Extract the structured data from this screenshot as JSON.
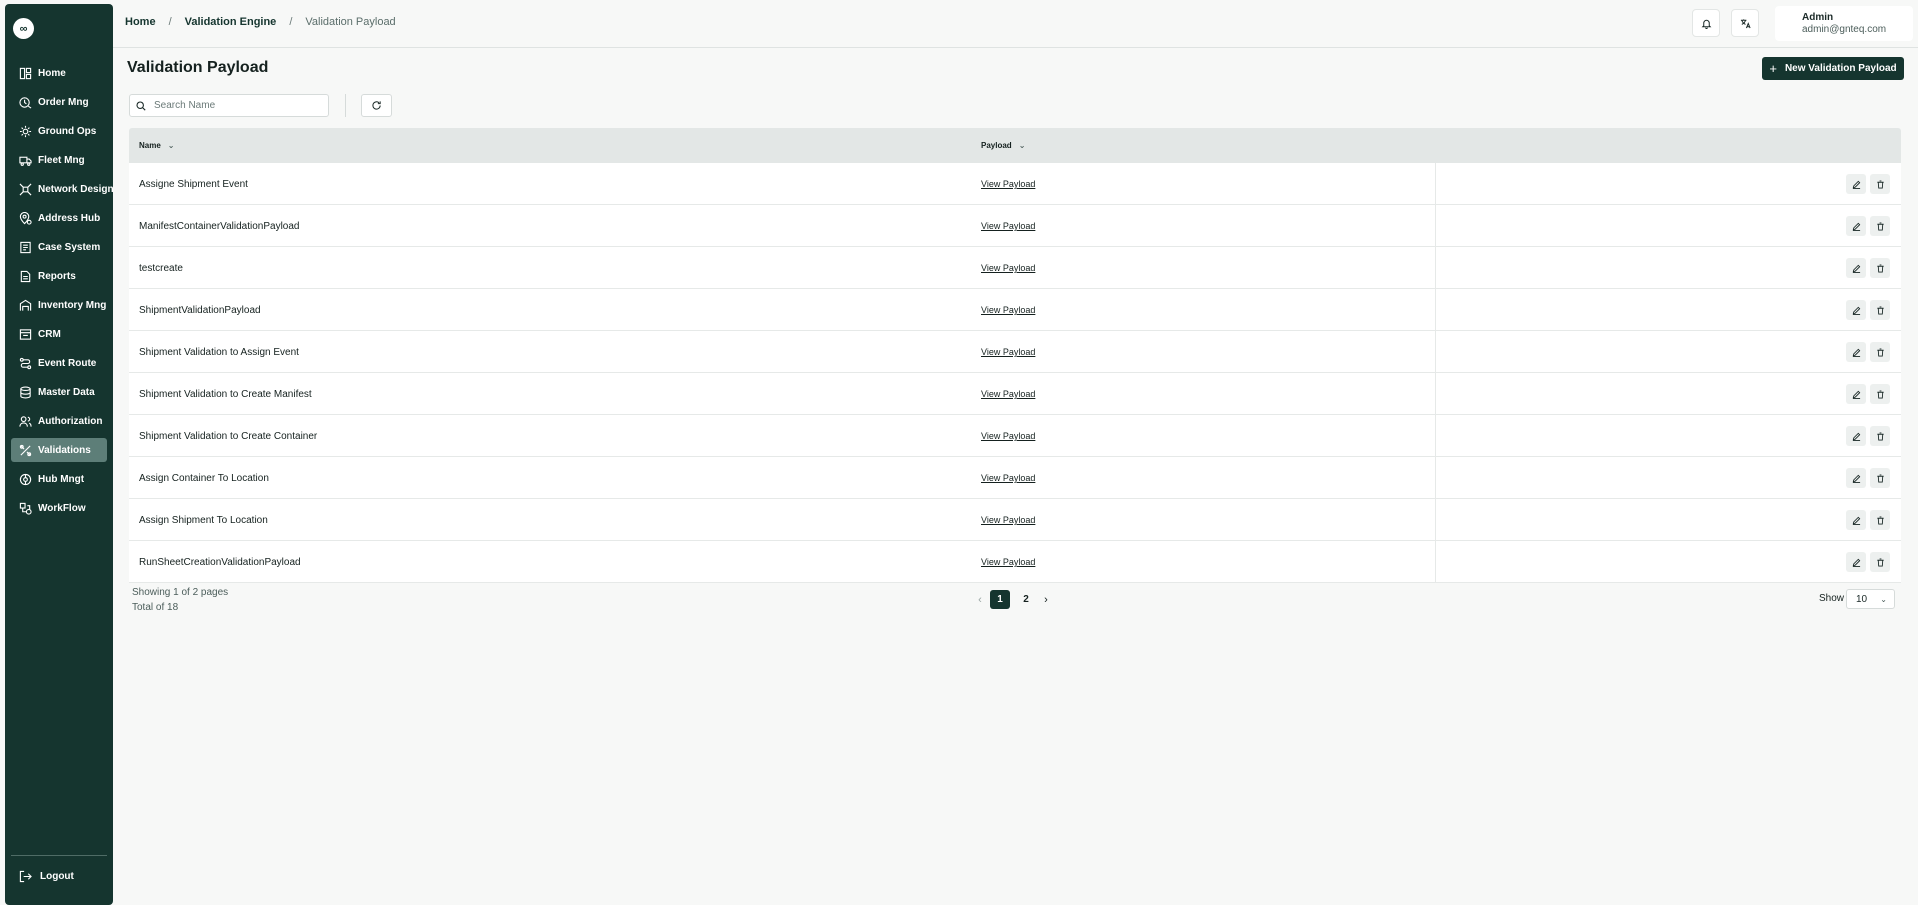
{
  "sidebar": {
    "logo": "∞",
    "items": [
      {
        "label": "Home",
        "icon": "home-icon"
      },
      {
        "label": "Order Mng",
        "icon": "order-icon"
      },
      {
        "label": "Ground Ops",
        "icon": "ground-ops-icon"
      },
      {
        "label": "Fleet Mng",
        "icon": "truck-icon"
      },
      {
        "label": "Network Design",
        "icon": "network-icon"
      },
      {
        "label": "Address Hub",
        "icon": "location-icon"
      },
      {
        "label": "Case System",
        "icon": "case-icon"
      },
      {
        "label": "Reports",
        "icon": "report-icon"
      },
      {
        "label": "Inventory Mng",
        "icon": "inventory-icon"
      },
      {
        "label": "CRM",
        "icon": "crm-icon"
      },
      {
        "label": "Event Route",
        "icon": "route-icon"
      },
      {
        "label": "Master Data",
        "icon": "database-icon"
      },
      {
        "label": "Authorization",
        "icon": "users-icon"
      },
      {
        "label": "Validations",
        "icon": "validations-icon"
      },
      {
        "label": "Hub Mngt",
        "icon": "hub-icon"
      },
      {
        "label": "WorkFlow",
        "icon": "workflow-icon"
      }
    ],
    "active_index": 13,
    "logout_label": "Logout"
  },
  "header": {
    "breadcrumb": {
      "home": "Home",
      "section": "Validation Engine",
      "current": "Validation Payload",
      "separator": "/"
    },
    "user": {
      "name": "Admin",
      "email": "admin@gnteq.com"
    }
  },
  "page": {
    "title": "Validation Payload",
    "new_button_label": "New Validation Payload",
    "search_placeholder": "Search Name"
  },
  "table": {
    "columns": {
      "name": "Name",
      "payload": "Payload"
    },
    "rows": [
      {
        "name": "Assigne Shipment Event",
        "payload": "View Payload"
      },
      {
        "name": "ManifestContainerValidationPayload",
        "payload": "View Payload"
      },
      {
        "name": "testcreate",
        "payload": "View Payload"
      },
      {
        "name": "ShipmentValidationPayload",
        "payload": "View Payload"
      },
      {
        "name": "Shipment Validation to Assign Event",
        "payload": "View Payload"
      },
      {
        "name": "Shipment Validation to Create Manifest",
        "payload": "View Payload"
      },
      {
        "name": "Shipment Validation to Create Container",
        "payload": "View Payload"
      },
      {
        "name": "Assign Container To Location",
        "payload": "View Payload"
      },
      {
        "name": "Assign Shipment To Location",
        "payload": "View Payload"
      },
      {
        "name": "RunSheetCreationValidationPayload",
        "payload": "View Payload"
      }
    ]
  },
  "pagination": {
    "showing": "Showing 1 of 2 pages",
    "total": "Total of 18",
    "pages": [
      "1",
      "2"
    ],
    "current_page": "1",
    "show_label": "Show",
    "page_size": "10"
  },
  "colors": {
    "sidebar_bg": "#15352f",
    "active_item": "#5d7e78",
    "primary": "#15352f"
  }
}
